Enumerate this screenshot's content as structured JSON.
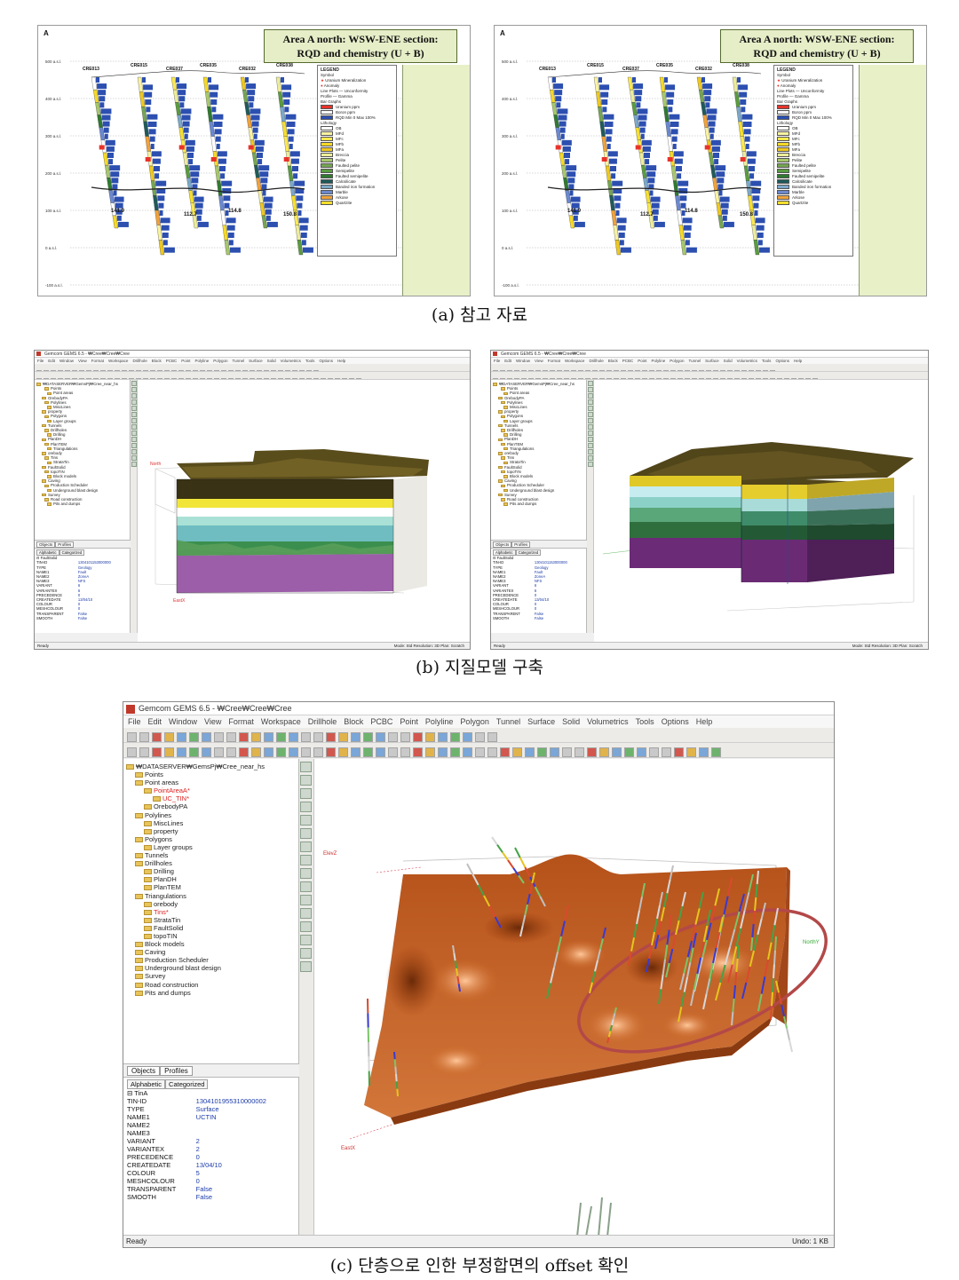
{
  "panel_a": {
    "caption": "(a) 참고 자료",
    "corner_label": "A",
    "title_line1": "Area A north: WSW-ENE section:",
    "title_line2": "RQD and chemistry (U + B)",
    "holes": [
      "CRE013",
      "CRE015",
      "CRE037",
      "CRE035",
      "CRE032",
      "CRE038"
    ],
    "elevations": [
      "500 a.s.l.",
      "400 a.s.l.",
      "300 a.s.l.",
      "200 a.s.l.",
      "100 a.s.l.",
      "0 a.s.l.",
      "-100 a.s.l."
    ],
    "values": [
      "141.9",
      "112.7",
      "114.8",
      "150.8"
    ],
    "legend": {
      "title": "LEGEND",
      "symbol_label": "Symbol",
      "symbols": [
        "Uranium Mineralization",
        "Anomaly"
      ],
      "line_plots_label": "Line Plots",
      "line_plot_item": "Unconformity",
      "profile_label": "Profile",
      "profile_item": "Gamma",
      "bar_graphs_label": "Bar Graphs",
      "bar_items": [
        "Uranium ppm",
        "Boron ppm",
        "RQD Min 0 Max 100%"
      ],
      "lithology_label": "Lithology",
      "lithology": [
        "OB",
        "MFd",
        "MFc",
        "MFb",
        "MFa",
        "Breccia",
        "Pelite",
        "Faulted pelite",
        "Semipelite",
        "Faulted semipelite",
        "Calcsilicate",
        "Banded iron formation",
        "Marble",
        "Arkose",
        "Quartzite"
      ],
      "colors": {
        "uranium": "#e8332a",
        "boron": "#f4f4f4",
        "rqd": "#2c4fb0",
        "lithology": [
          "#ffffff",
          "#f8f2a0",
          "#fbe94f",
          "#f6d925",
          "#eec81e",
          "#ecec9a",
          "#a7c76b",
          "#75a552",
          "#5a9c3e",
          "#2f7a2f",
          "#1f5a5a",
          "#7ba8c8",
          "#6b89d0",
          "#f1a23a",
          "#f6df2c"
        ]
      }
    }
  },
  "panel_b": {
    "caption": "(b) 지질모델 구축",
    "window_title": "Gemcom GEMS 6.5 - ₩Cree₩Cree₩Cree",
    "menu": [
      "File",
      "Edit",
      "Window",
      "View",
      "Format",
      "Workspace",
      "Drillhole",
      "Block",
      "PCBC",
      "Point",
      "Polyline",
      "Polygon",
      "Tunnel",
      "Surface",
      "Solid",
      "Volumetrics",
      "Tools",
      "Options",
      "Help"
    ],
    "tree": [
      "₩DATASERVER₩GemsPj₩Cree_near_hs",
      "Points",
      "Point areas",
      "OrebodyPA",
      "Polylines",
      "MiscLines",
      "property",
      "Polygons",
      "Layer groups",
      "Tunnels",
      "Drillholes",
      "Drilling",
      "PlanDH",
      "PlanTEM",
      "Triangulations",
      "orebody",
      "Tins",
      "StrataTin",
      "FaultSolid",
      "topoTIN",
      "Block models",
      "Caving",
      "Production Scheduler",
      "Underground blast design",
      "Survey",
      "Road construction",
      "Pits and dumps"
    ],
    "tabs": [
      "Objects",
      "Profiles"
    ],
    "prop_tabs": [
      "Alphabetic",
      "Categorized"
    ],
    "props_group": "FaultSolid",
    "props": [
      {
        "k": "TIN-ID",
        "v": "1304101153000000"
      },
      {
        "k": "TYPE",
        "v": "Geology"
      },
      {
        "k": "NAME1",
        "v": "Fault"
      },
      {
        "k": "NAME2",
        "v": "ZoneA"
      },
      {
        "k": "NAME3",
        "v": "NFS"
      },
      {
        "k": "VARIANT",
        "v": "6"
      },
      {
        "k": "VARIANTEX",
        "v": "6"
      },
      {
        "k": "PRECEDENCE",
        "v": "0"
      },
      {
        "k": "CREATEDATE",
        "v": "13/04/10"
      },
      {
        "k": "COLOUR",
        "v": "0"
      },
      {
        "k": "MESHCOLOUR",
        "v": "0"
      },
      {
        "k": "TRANSPARENT",
        "v": "False"
      },
      {
        "k": "SMOOTH",
        "v": "False"
      }
    ],
    "status_left": "Ready",
    "status_right": "Mode: Std    Resolution: 3D    Plan: Scratch",
    "view_labels": [
      "North",
      "EastX"
    ]
  },
  "panel_c": {
    "caption": "(c) 단층으로 인한 부정합면의 offset 확인",
    "window_title": "Gemcom GEMS 6.5 - ₩Cree₩Cree₩Cree",
    "menu": [
      "File",
      "Edit",
      "Window",
      "View",
      "Format",
      "Workspace",
      "Drillhole",
      "Block",
      "PCBC",
      "Point",
      "Polyline",
      "Polygon",
      "Tunnel",
      "Surface",
      "Solid",
      "Volumetrics",
      "Tools",
      "Options",
      "Help"
    ],
    "tree": [
      {
        "t": "₩DATASERVER₩GemsPj₩Cree_near_hs",
        "d": 0
      },
      {
        "t": "Points",
        "d": 1
      },
      {
        "t": "Point areas",
        "d": 1
      },
      {
        "t": "PointAreaA*",
        "d": 2,
        "red": true
      },
      {
        "t": "UC_TIN*",
        "d": 3,
        "red": true
      },
      {
        "t": "OrebodyPA",
        "d": 2
      },
      {
        "t": "Polylines",
        "d": 1
      },
      {
        "t": "MiscLines",
        "d": 2
      },
      {
        "t": "property",
        "d": 2
      },
      {
        "t": "Polygons",
        "d": 1
      },
      {
        "t": "Layer groups",
        "d": 2
      },
      {
        "t": "Tunnels",
        "d": 1
      },
      {
        "t": "Drillholes",
        "d": 1
      },
      {
        "t": "Drilling",
        "d": 2
      },
      {
        "t": "PlanDH",
        "d": 2
      },
      {
        "t": "PlanTEM",
        "d": 2
      },
      {
        "t": "Triangulations",
        "d": 1
      },
      {
        "t": "orebody",
        "d": 2
      },
      {
        "t": "Tins*",
        "d": 2,
        "red": true
      },
      {
        "t": "StrataTin",
        "d": 2
      },
      {
        "t": "FaultSolid",
        "d": 2
      },
      {
        "t": "topoTIN",
        "d": 2
      },
      {
        "t": "Block models",
        "d": 1
      },
      {
        "t": "Caving",
        "d": 1
      },
      {
        "t": "Production Scheduler",
        "d": 1
      },
      {
        "t": "Underground blast design",
        "d": 1
      },
      {
        "t": "Survey",
        "d": 1
      },
      {
        "t": "Road construction",
        "d": 1
      },
      {
        "t": "Pits and dumps",
        "d": 1
      }
    ],
    "tabs": [
      "Objects",
      "Profiles"
    ],
    "prop_tabs": [
      "Alphabetic",
      "Categorized"
    ],
    "props_group": "TinA",
    "props": [
      {
        "k": "TIN-ID",
        "v": "1304101955310000002"
      },
      {
        "k": "TYPE",
        "v": "Surface"
      },
      {
        "k": "NAME1",
        "v": "UCTIN"
      },
      {
        "k": "NAME2",
        "v": ""
      },
      {
        "k": "NAME3",
        "v": ""
      },
      {
        "k": "VARIANT",
        "v": "2"
      },
      {
        "k": "VARIANTEX",
        "v": "2"
      },
      {
        "k": "PRECEDENCE",
        "v": "0"
      },
      {
        "k": "CREATEDATE",
        "v": "13/04/10"
      },
      {
        "k": "COLOUR",
        "v": "5"
      },
      {
        "k": "MESHCOLOUR",
        "v": "0"
      },
      {
        "k": "TRANSPARENT",
        "v": "False"
      },
      {
        "k": "SMOOTH",
        "v": "False"
      }
    ],
    "status_left": "Ready",
    "status_right": "Undo: 1 KB",
    "view_labels": [
      "ElevZ",
      "EastX",
      "NorthY"
    ]
  }
}
